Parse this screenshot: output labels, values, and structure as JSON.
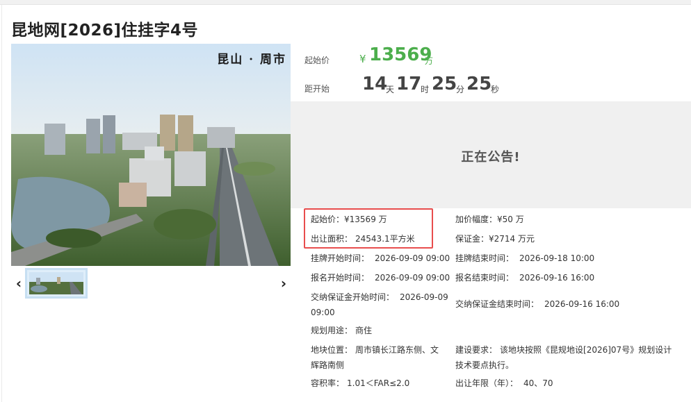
{
  "title": "昆地网[2026]住挂字4号",
  "hero": {
    "watermark": "昆山 · 周市",
    "prev_icon": "‹",
    "next_icon": "›"
  },
  "price": {
    "label": "起始价",
    "currency": "¥",
    "value": "13569",
    "unit": "万"
  },
  "countdown": {
    "label": "距开始",
    "days": "14",
    "days_unit": "天",
    "hours": "17",
    "hours_unit": "时",
    "minutes": "25",
    "minutes_unit": "分",
    "seconds": "25",
    "seconds_unit": "秒"
  },
  "notice": "正在公告!",
  "details": {
    "start_price": {
      "label": "起始价：",
      "value": "¥13569 万"
    },
    "increment": {
      "label": "加价幅度：",
      "value": "¥50 万"
    },
    "area": {
      "label": "出让面积：",
      "value": "24543.1平方米"
    },
    "deposit": {
      "label": "保证金：",
      "value": "¥2714 万元"
    },
    "listing_start": {
      "label": "挂牌开始时间：",
      "value": "2026-09-09 09:00"
    },
    "listing_end": {
      "label": "挂牌结束时间：",
      "value": "2026-09-18 10:00"
    },
    "signup_start": {
      "label": "报名开始时间：",
      "value": "2026-09-09 09:00"
    },
    "signup_end": {
      "label": "报名结束时间：",
      "value": "2026-09-16 16:00"
    },
    "deposit_start": {
      "label": "交纳保证金开始时间：",
      "value_line1": "2026-09-09",
      "value_line2": "09:00"
    },
    "deposit_end": {
      "label": "交纳保证金结束时间：",
      "value": "2026-09-16 16:00"
    },
    "usage": {
      "label": "规划用途：",
      "value": "商住"
    },
    "location": {
      "label": "地块位置：",
      "value_line1": "周市镇长江路东侧、文",
      "value_line2": "辉路南侧"
    },
    "requirement": {
      "label": "建设要求：",
      "value_line1": "该地块按照《昆规地设[2026]07号》规划设计",
      "value_line2": "技术要点执行。"
    },
    "far": {
      "label": "容积率：",
      "value": "1.01＜FAR≤2.0"
    },
    "years": {
      "label": "出让年限（年）：",
      "value": "40、70"
    }
  },
  "colors": {
    "accent_green": "#4cae4c",
    "highlight_red": "#e84d4d",
    "notice_bg": "#f0f0f0"
  }
}
